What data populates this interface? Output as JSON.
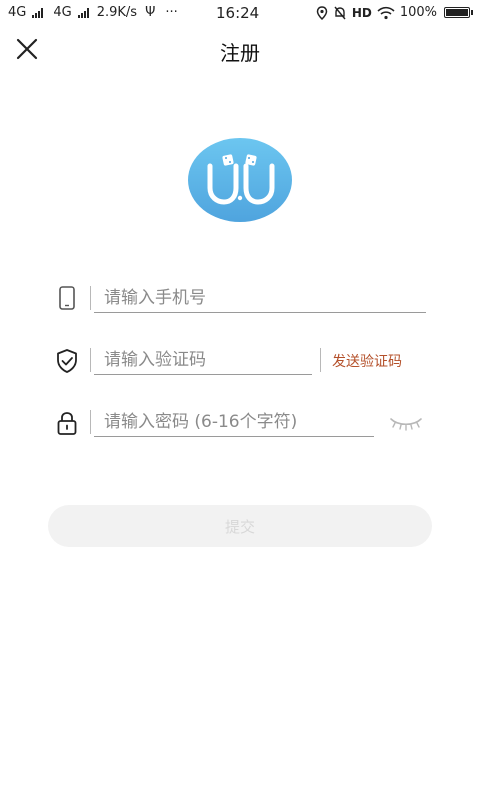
{
  "status_bar": {
    "net1": "4G",
    "net2": "4G",
    "speed": "2.9K/s",
    "usb": "Ψ",
    "more": "···",
    "time": "16:24",
    "hd": "HD",
    "battery_pct": "100%"
  },
  "header": {
    "title": "注册",
    "close_icon": "close-icon"
  },
  "logo": {
    "text": "U.U",
    "color": "#5bb2e3"
  },
  "form": {
    "phone": {
      "placeholder": "请输入手机号",
      "icon": "phone-icon"
    },
    "code": {
      "placeholder": "请输入验证码",
      "icon": "shield-icon",
      "send_label": "发送验证码"
    },
    "password": {
      "placeholder": "请输入密码 (6-16个字符)",
      "icon": "lock-icon",
      "toggle_icon": "eye-closed-icon"
    }
  },
  "submit": {
    "label": "提交"
  },
  "colors": {
    "accent_link": "#b4502a",
    "disabled_button_bg": "#f2f2f2",
    "disabled_button_text": "#d8d8d8"
  }
}
